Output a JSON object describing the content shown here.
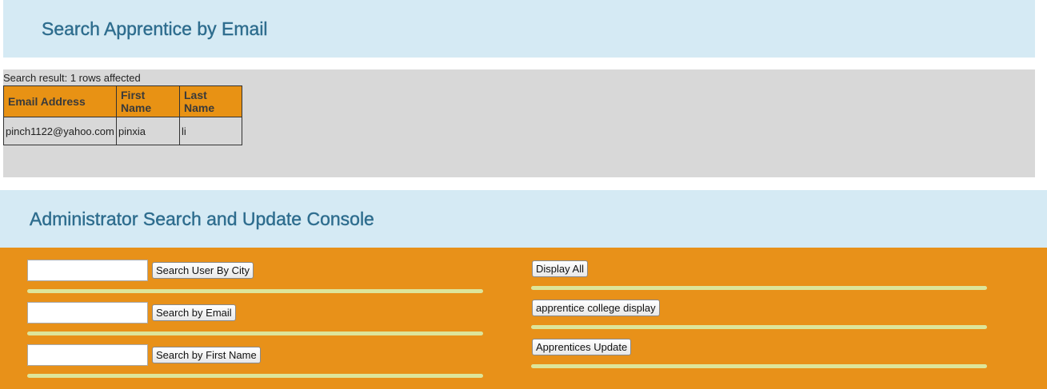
{
  "search_section": {
    "title": "Search Apprentice by Email",
    "result_text": "Search result: 1 rows affected",
    "columns": [
      "Email Address",
      "First Name",
      "Last Name"
    ],
    "rows": [
      [
        "pinch1122@yahoo.com",
        "pinxia",
        "li"
      ]
    ]
  },
  "console": {
    "title": "Administrator Search and Update Console",
    "left": {
      "city_input_value": "",
      "city_button": "Search User By City",
      "email_input_value": "",
      "email_button": "Search by Email",
      "first_name_input_value": "",
      "first_name_button": "Search by First Name"
    },
    "right": {
      "display_all_button": "Display All",
      "college_display_button": "apprentice college display",
      "update_button": "Apprentices Update"
    }
  },
  "colors": {
    "banner_bg": "#d5eaf4",
    "heading": "#2e6d8e",
    "panel_bg": "#d8d8d8",
    "accent_orange": "#e89119",
    "separator": "#dde59a"
  }
}
